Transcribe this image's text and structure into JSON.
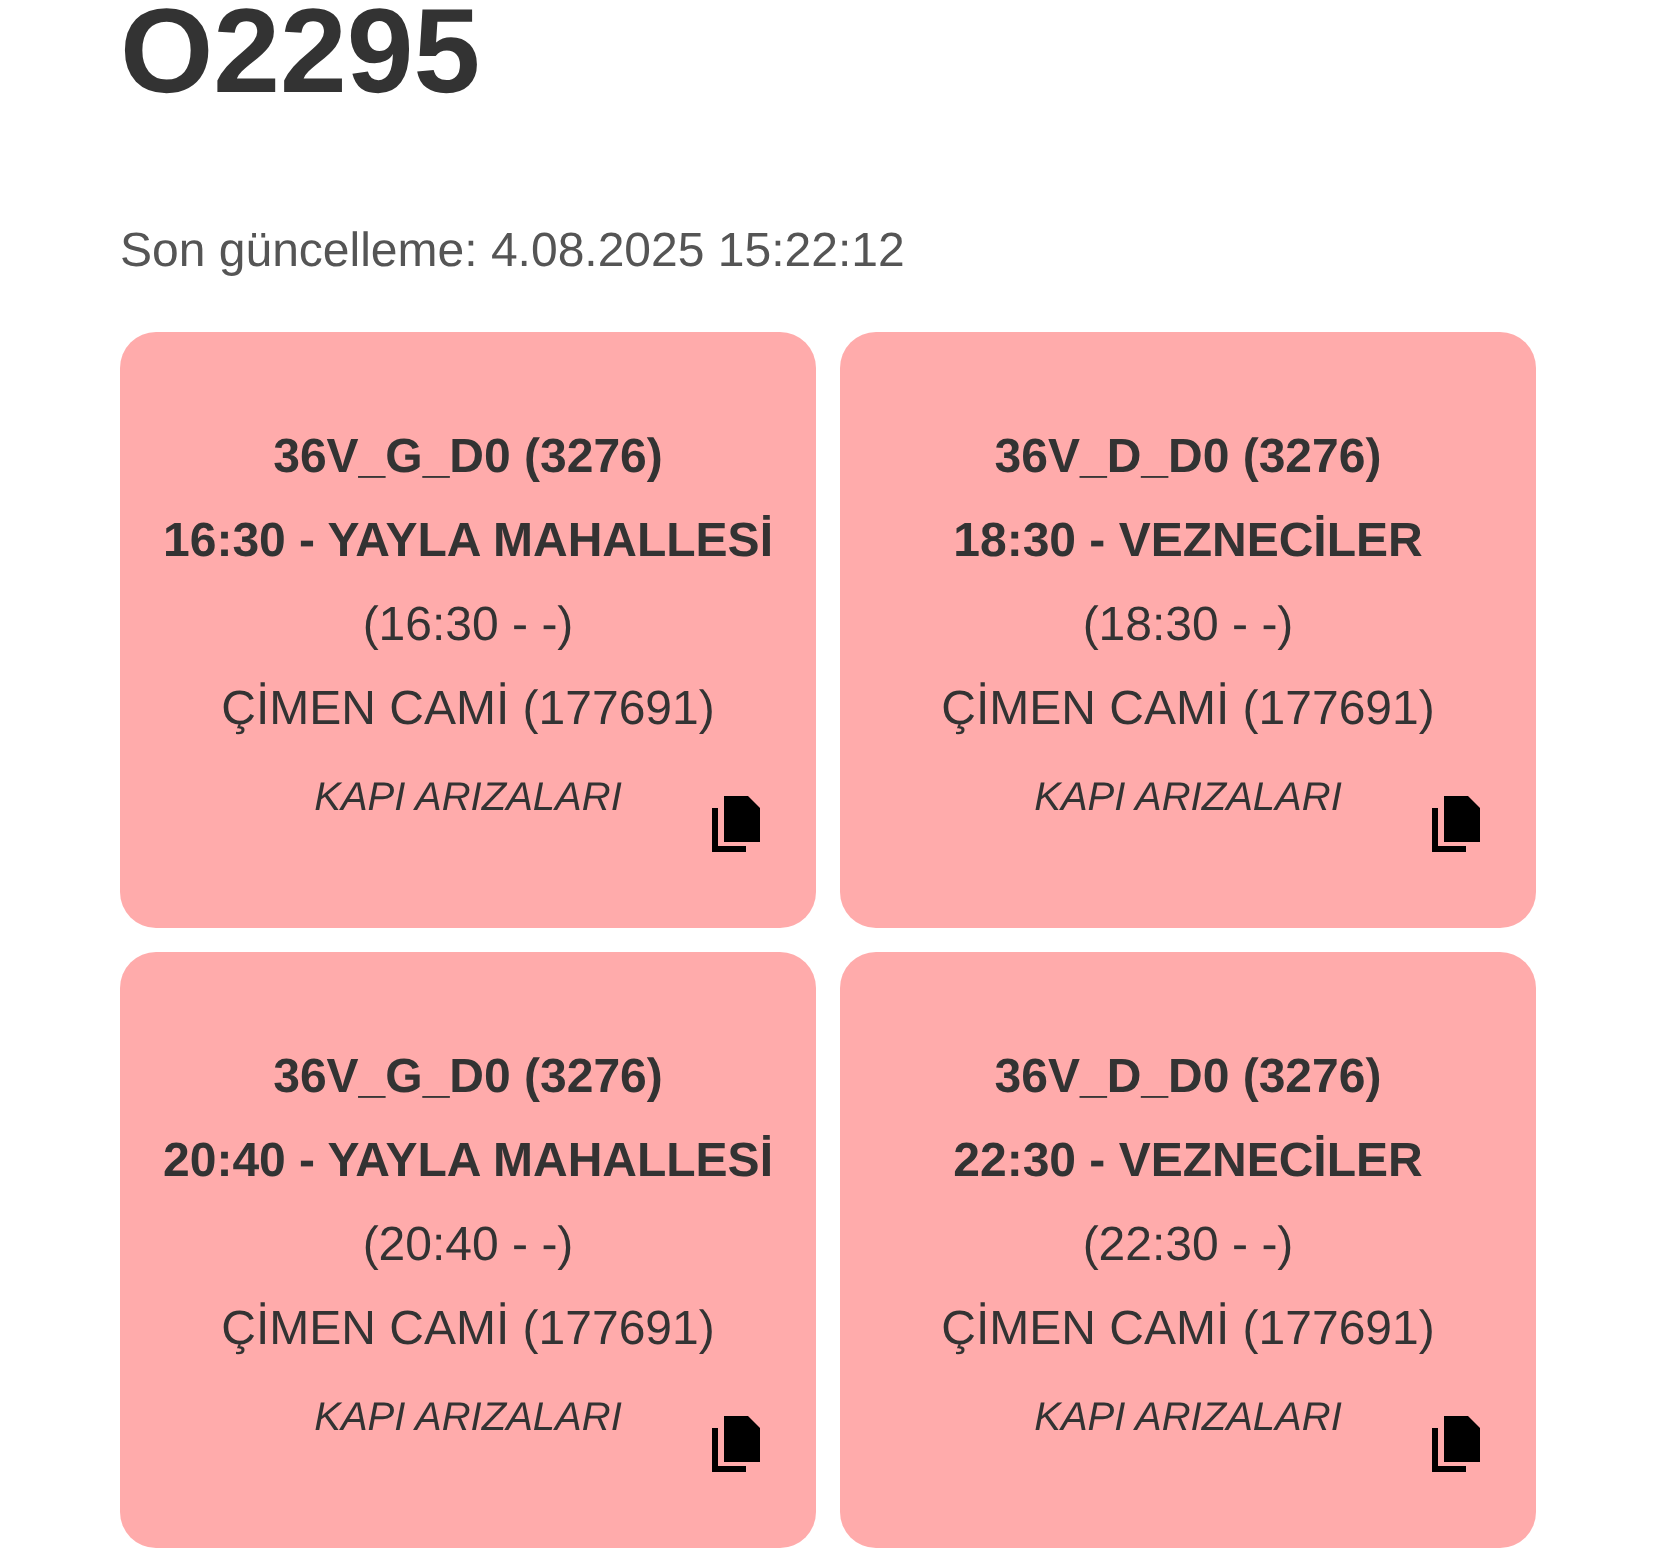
{
  "title": "O2295",
  "last_update": "Son güncelleme: 4.08.2025 15:22:12",
  "cards": [
    {
      "route": "36V_G_D0 (3276)",
      "trip": "16:30 - YAYLA MAHALLESİ",
      "times": "(16:30 - -)",
      "stop": "ÇİMEN CAMİ (177691)",
      "note": "KAPI ARIZALARI"
    },
    {
      "route": "36V_D_D0 (3276)",
      "trip": "18:30 - VEZNECİLER",
      "times": "(18:30 - -)",
      "stop": "ÇİMEN CAMİ (177691)",
      "note": "KAPI ARIZALARI"
    },
    {
      "route": "36V_G_D0 (3276)",
      "trip": "20:40 - YAYLA MAHALLESİ",
      "times": "(20:40 - -)",
      "stop": "ÇİMEN CAMİ (177691)",
      "note": "KAPI ARIZALARI"
    },
    {
      "route": "36V_D_D0 (3276)",
      "trip": "22:30 - VEZNECİLER",
      "times": "(22:30 - -)",
      "stop": "ÇİMEN CAMİ (177691)",
      "note": "KAPI ARIZALARI"
    }
  ]
}
